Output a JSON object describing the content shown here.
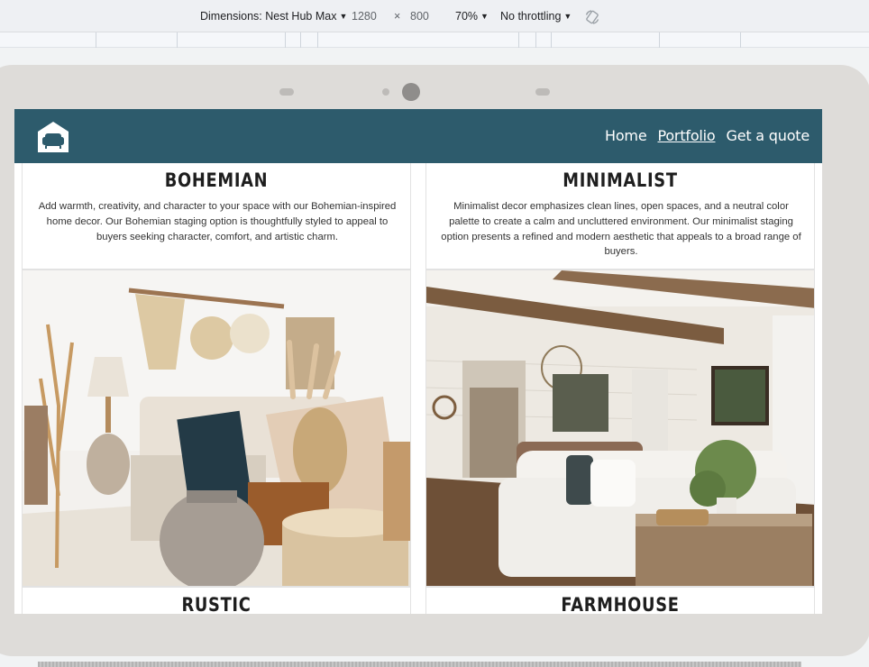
{
  "devtools": {
    "dimensions_label": "Dimensions: Nest Hub Max",
    "width": "1280",
    "times": "×",
    "height": "800",
    "zoom": "70%",
    "throttling": "No throttling"
  },
  "site": {
    "nav": {
      "home": "Home",
      "portfolio": "Portfolio",
      "quote": "Get a quote"
    },
    "cards": [
      {
        "title": "BOHEMIAN",
        "description": "Add warmth, creativity, and character to your space with our Bohemian-inspired home decor. Our Bohemian staging option is thoughtfully styled to appeal to buyers seeking character, comfort, and artistic charm."
      },
      {
        "title": "MINIMALIST",
        "description": "Minimalist decor emphasizes clean lines, open spaces, and a neutral color palette to create a calm and uncluttered environment. Our minimalist staging option presents a refined and modern aesthetic that appeals to a broad range of buyers."
      }
    ],
    "next_cards": [
      {
        "title": "RUSTIC"
      },
      {
        "title": "FARMHOUSE"
      }
    ]
  },
  "colors": {
    "navbar": "#2d5b6c",
    "device_frame": "#dedcd9"
  },
  "icons": [
    "caret-down-icon",
    "rotate-icon",
    "sofa-logo-icon"
  ]
}
